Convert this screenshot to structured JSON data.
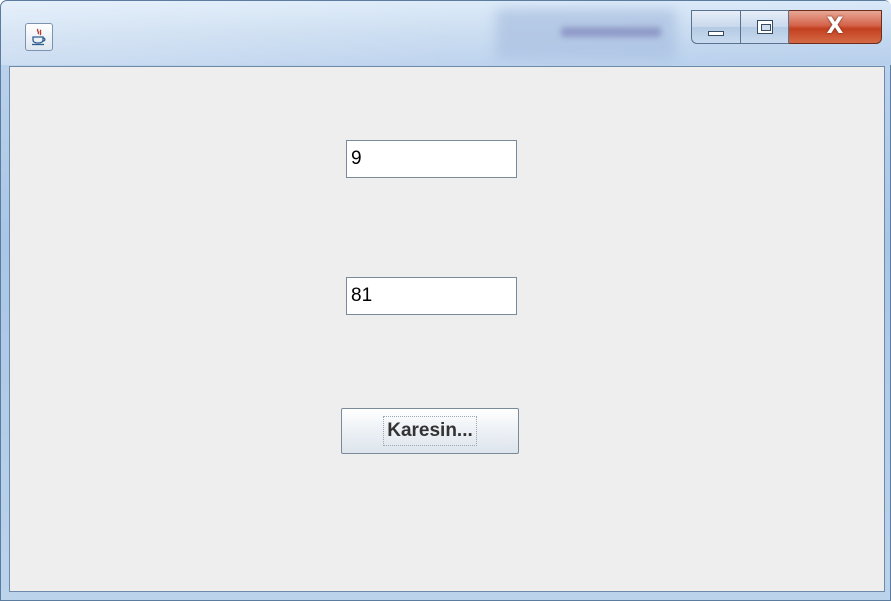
{
  "window": {
    "title": "",
    "icon": "java-cup-icon",
    "controls": {
      "minimize": "minimize-icon",
      "maximize": "maximize-icon",
      "close_label": "X"
    }
  },
  "form": {
    "input_value": "9",
    "result_value": "81",
    "button_label": "Karesin..."
  },
  "colors": {
    "client_background": "#eeeeee",
    "close_button": "#c4401f",
    "titlebar": "#c3d8ef"
  }
}
